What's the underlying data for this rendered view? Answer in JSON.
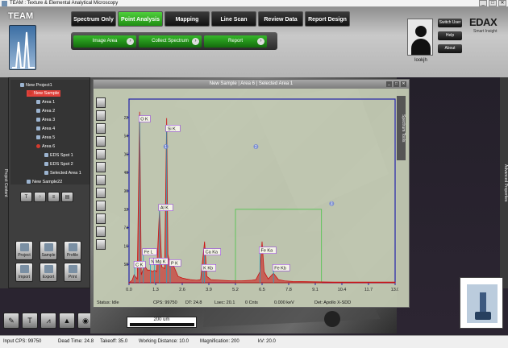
{
  "window": {
    "title": "TEAM : Texture & Elemental Analytical Microscopy"
  },
  "header": {
    "logo_text": "TEAM",
    "main_tabs": [
      {
        "label": "Spectrum Only"
      },
      {
        "label": "Point Analysis"
      },
      {
        "label": "Mapping"
      },
      {
        "label": "Line Scan"
      },
      {
        "label": "Review Data"
      },
      {
        "label": "Report Design"
      }
    ],
    "sub_tabs": [
      {
        "label": "Image Area"
      },
      {
        "label": "Collect Spectrum"
      },
      {
        "label": "Report"
      }
    ],
    "user": {
      "name": "lookjh",
      "switch_user": "Switch User",
      "help": "Help",
      "about": "About"
    },
    "brand": "EDAX",
    "brand_sub": "Smart Insight"
  },
  "left_panel": {
    "tab_label": "Project Content",
    "tree": [
      {
        "label": "New Project1"
      },
      {
        "label": "New Sample"
      },
      {
        "label": "Area 1"
      },
      {
        "label": "Area 2"
      },
      {
        "label": "Area 3"
      },
      {
        "label": "Area 4"
      },
      {
        "label": "Area 5"
      },
      {
        "label": "Area 6"
      },
      {
        "label": "EDS Spot 1"
      },
      {
        "label": "EDS Spot 2"
      },
      {
        "label": "Selected Area 1"
      },
      {
        "label": "New Sample22"
      }
    ],
    "actions": [
      {
        "label": "Project"
      },
      {
        "label": "Sample"
      },
      {
        "label": "Profile"
      },
      {
        "label": "Import"
      },
      {
        "label": "Export"
      },
      {
        "label": "Print"
      }
    ]
  },
  "right_panel": {
    "tab_label": "Advanced Properties"
  },
  "spectrum_window": {
    "title": "New Sample | Area 6 | Selected Area 1",
    "tools_tab": "Spectrum Tools",
    "status": {
      "state": "Status: Idle",
      "cps": "CPS: 99750",
      "dt": "DT: 24.8",
      "lsec": "Lsec: 20.1",
      "cnts": "0 Cnts",
      "kev": "0.000 keV",
      "det": "Det: Apollo X-SDD"
    }
  },
  "chart_data": {
    "type": "line",
    "xlabel": "",
    "ylabel": "",
    "xlim": [
      0,
      13
    ],
    "ylim": [
      0,
      580
    ],
    "x_ticks": [
      "0.0",
      "1.3",
      "2.6",
      "3.9",
      "5.2",
      "6.5",
      "7.8",
      "9.1",
      "10.4",
      "11.7",
      "13.0"
    ],
    "y_ticks": [
      "58",
      "116",
      "174",
      "232",
      "290",
      "348",
      "406",
      "464",
      "522"
    ],
    "series": [
      {
        "x": [
          0.0,
          0.15,
          0.25,
          0.4,
          0.52,
          0.6,
          0.75,
          0.9,
          1.04,
          1.15,
          1.25,
          1.35,
          1.49,
          1.6,
          1.74,
          1.84,
          1.9,
          2.0,
          2.1,
          2.2,
          2.4,
          2.6,
          2.8,
          3.0,
          3.31,
          3.5,
          3.69,
          3.8,
          4.0,
          4.5,
          5.0,
          5.5,
          6.0,
          6.2,
          6.4,
          6.5,
          6.6,
          6.8,
          7.06,
          7.3,
          7.6,
          8.0,
          9.0,
          10.0,
          11.0,
          12.0,
          13.0
        ],
        "y": [
          0,
          8,
          25,
          12,
          540,
          25,
          55,
          40,
          40,
          35,
          40,
          35,
          230,
          50,
          45,
          520,
          90,
          60,
          60,
          50,
          20,
          15,
          12,
          10,
          8,
          10,
          130,
          20,
          10,
          8,
          6,
          6,
          8,
          10,
          35,
          130,
          35,
          12,
          30,
          10,
          6,
          4,
          3,
          2,
          2,
          2,
          2
        ]
      }
    ],
    "peak_labels": [
      {
        "label": "O K",
        "x": 0.52
      },
      {
        "label": "Si K",
        "x": 1.84
      },
      {
        "label": "Al K",
        "x": 1.49
      },
      {
        "label": "Fe L",
        "x": 0.7
      },
      {
        "label": "Na K",
        "x": 1.04
      },
      {
        "label": "Mg K",
        "x": 1.25
      },
      {
        "label": "P K",
        "x": 2.01
      },
      {
        "label": "C K",
        "x": 0.28
      },
      {
        "label": "Ca Ka",
        "x": 3.69
      },
      {
        "label": "K Kb",
        "x": 3.59
      },
      {
        "label": "Fe Ka",
        "x": 6.4
      },
      {
        "label": "Fe Kb",
        "x": 7.06
      }
    ],
    "colors": {
      "line": "#cc1111",
      "axis": "#2222aa",
      "marker": "#1aa6c7"
    }
  },
  "image": {
    "scale_label": "200 um",
    "point_labels": [
      "1",
      "2",
      "3"
    ]
  },
  "statusbar": {
    "input_cps": "Input CPS: 99750",
    "dead_time": "Dead Time: 24.8",
    "takeoff": "Takeoff: 35.0",
    "working_distance": "Working Distance: 10.0",
    "magnification": "Magnification: 200",
    "kv": "kV: 20.0"
  }
}
